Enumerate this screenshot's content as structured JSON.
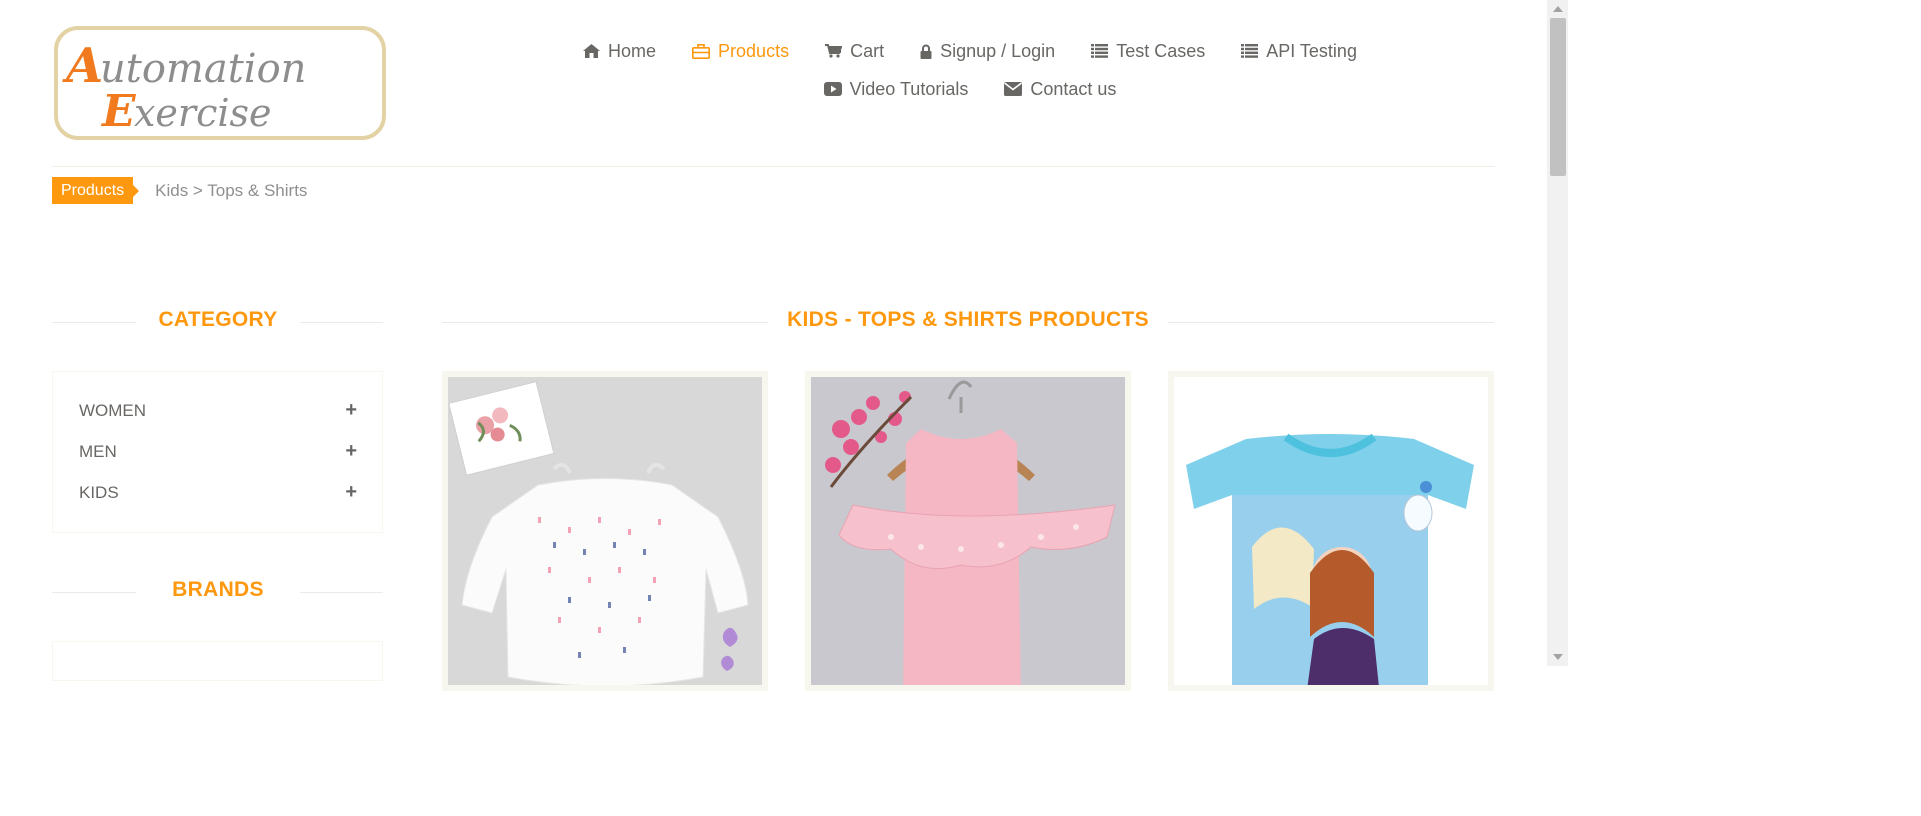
{
  "logo": {
    "line1": "Automation",
    "line2": "Exercise"
  },
  "nav": {
    "row1": [
      {
        "label": "Home",
        "icon": "home-icon"
      },
      {
        "label": "Products",
        "icon": "briefcase-icon",
        "active": true
      },
      {
        "label": "Cart",
        "icon": "cart-icon"
      },
      {
        "label": "Signup / Login",
        "icon": "lock-icon"
      },
      {
        "label": "Test Cases",
        "icon": "list-icon"
      },
      {
        "label": "API Testing",
        "icon": "list-icon"
      }
    ],
    "row2": [
      {
        "label": "Video Tutorials",
        "icon": "youtube-play-icon"
      },
      {
        "label": "Contact us",
        "icon": "envelope-icon"
      }
    ]
  },
  "breadcrumb": {
    "tag": "Products",
    "path": "Kids > Tops & Shirts"
  },
  "sidebar": {
    "category_title": "CATEGORY",
    "categories": [
      {
        "label": "WOMEN",
        "toggle": "+"
      },
      {
        "label": "MEN",
        "toggle": "+"
      },
      {
        "label": "KIDS",
        "toggle": "+"
      }
    ],
    "brands_title": "BRANDS"
  },
  "main": {
    "title": "KIDS - TOPS & SHIRTS PRODUCTS",
    "products": [
      {
        "image": "white-printed-top-image"
      },
      {
        "image": "pink-ruffle-top-image"
      },
      {
        "image": "frozen-tshirt-image"
      }
    ]
  },
  "colors": {
    "accent": "#FE980F",
    "text": "#696763"
  }
}
